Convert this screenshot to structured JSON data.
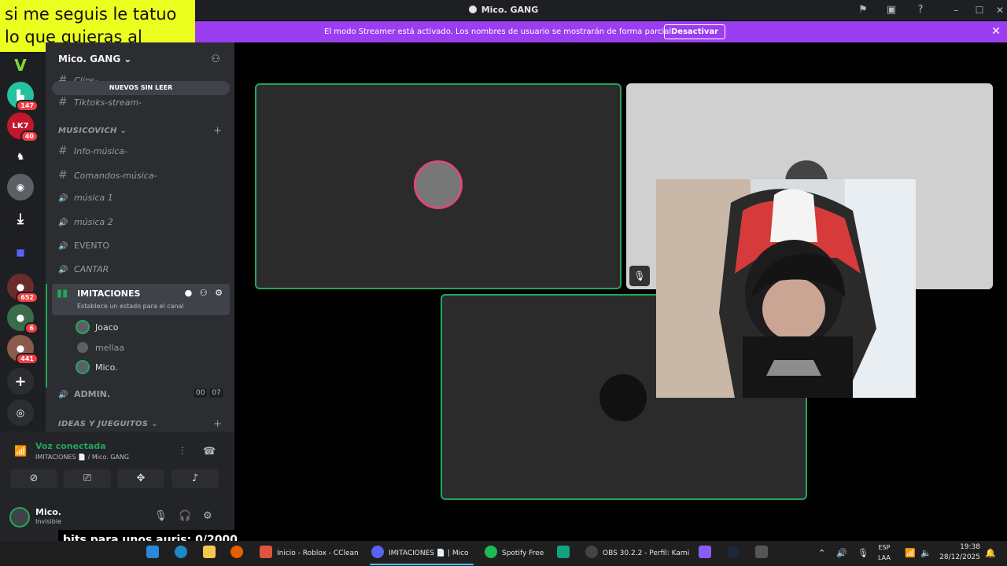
{
  "window": {
    "title": "Mico. GANG"
  },
  "overlay_text": "si me seguis le tatuo lo que quieras al BEBE :)",
  "streamer_bar": {
    "message": "El modo Streamer está activado. Los nombres de usuario se mostrarán de forma parcial.",
    "button": "Desactivar",
    "close": "✕"
  },
  "servers": {
    "badges": [
      "147",
      "40",
      "652",
      "6",
      "441"
    ],
    "labels": [
      "LK7"
    ]
  },
  "server": {
    "name": "Mico. GANG",
    "unread_pill": "NUEVOS SIN LEER",
    "channels_top": [
      {
        "sym": "#",
        "name": "Clips-"
      },
      {
        "sym": "#",
        "name": "Tiktoks-stream-"
      }
    ],
    "category1": "MUSICOVICH",
    "channels_music": [
      {
        "sym": "#",
        "name": "Info-música-"
      },
      {
        "sym": "#",
        "name": "Comandos-música-"
      },
      {
        "sym": "🔊",
        "name": "música 1"
      },
      {
        "sym": "🔊",
        "name": "música 2"
      },
      {
        "sym": "🔊",
        "name": "EVENTO"
      },
      {
        "sym": "🔊",
        "name": "CANTAR"
      }
    ],
    "active_channel": {
      "name": "IMITACIONES",
      "subtitle": "Establece un estado para el canal"
    },
    "voice_users": [
      "Joaco",
      "mellaa",
      "Mico."
    ],
    "admin_channel": "ADMIN.",
    "admin_counts": [
      "00",
      "07"
    ],
    "category2": "IDEAS Y JUEGUITOS"
  },
  "voice_panel": {
    "status": "Voz conectada",
    "channel": "IMITACIONES 📄 / Mico. GANG"
  },
  "user": {
    "name": "Mico.",
    "status": "Invisible"
  },
  "bits_text": "bits para unos auris: 0/2000",
  "taskbar": {
    "apps": [
      {
        "label": "Inicio - Roblox - CClean",
        "color": "#e0533d"
      },
      {
        "label": "IMITACIONES 📄 | Mico",
        "color": "#5865f2"
      },
      {
        "label": "Spotify Free",
        "color": "#1db954"
      },
      {
        "label": "OBS 30.2.2 - Perfil: Kami",
        "color": "#444444"
      }
    ],
    "lang_top": "ESP",
    "lang_bottom": "LAA",
    "time": "19:38",
    "date": "28/12/2025"
  },
  "colors": {
    "accent": "#9b3df0",
    "voice_green": "#23a55a",
    "overlay_yellow": "#eaff1e"
  }
}
